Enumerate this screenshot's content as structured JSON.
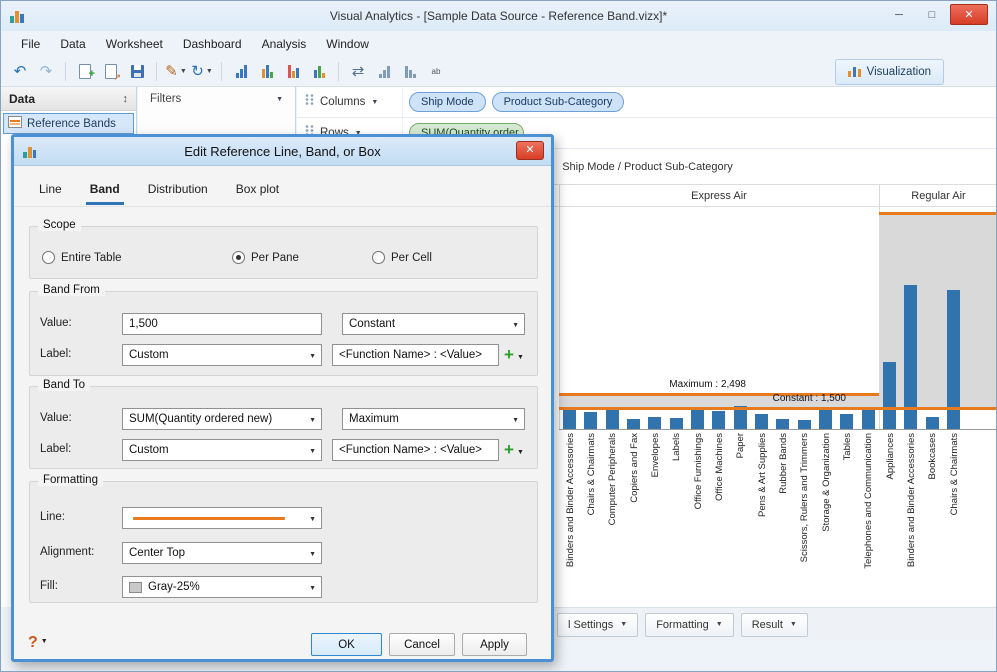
{
  "window": {
    "title": "Visual Analytics - [Sample Data Source - Reference Band.vizx]*",
    "menus": [
      "File",
      "Data",
      "Worksheet",
      "Dashboard",
      "Analysis",
      "Window"
    ],
    "visualization_tab": "Visualization"
  },
  "toolbar": {
    "icons": [
      "undo",
      "redo",
      "sep",
      "new-worksheet",
      "duplicate",
      "save",
      "sep",
      "format-painter",
      "refresh",
      "sep",
      "bar-chart",
      "dashboard",
      "highlight",
      "labels",
      "sep",
      "swap-axes",
      "sort-ascending",
      "sort-descending",
      "text-labels"
    ]
  },
  "panels": {
    "data_header": "Data",
    "reference_bands_item": "Reference Bands",
    "filters_header": "Filters",
    "columns_label": "Columns",
    "rows_label": "Rows",
    "column_pills": [
      "Ship Mode",
      "Product Sub-Category"
    ],
    "row_pills": [
      "SUM(Quantity order"
    ]
  },
  "bottom_bar": {
    "tabs": [
      "l Settings",
      "Formatting",
      "Result"
    ]
  },
  "dialog": {
    "title": "Edit Reference Line, Band, or Box",
    "tabs": [
      "Line",
      "Band",
      "Distribution",
      "Box plot"
    ],
    "active_tab": "Band",
    "scope": {
      "caption": "Scope",
      "options": [
        "Entire Table",
        "Per Pane",
        "Per Cell"
      ],
      "selected_index": 1
    },
    "band_from": {
      "caption": "Band From",
      "value_label": "Value:",
      "value": "1,500",
      "aggregation": "Constant",
      "label_label": "Label:",
      "label_mode": "Custom",
      "label_format": "<Function Name> : <Value>"
    },
    "band_to": {
      "caption": "Band To",
      "value_label": "Value:",
      "value": "SUM(Quantity ordered new)",
      "aggregation": "Maximum",
      "label_label": "Label:",
      "label_mode": "Custom",
      "label_format": "<Function Name> : <Value>"
    },
    "formatting": {
      "caption": "Formatting",
      "line_label": "Line:",
      "line_color": "#e87a1e",
      "alignment_label": "Alignment:",
      "alignment": "Center Top",
      "fill_label": "Fill:",
      "fill": "Gray-25%",
      "fill_swatch": "#c9c9c9"
    },
    "buttons": {
      "ok": "OK",
      "cancel": "Cancel",
      "apply": "Apply"
    }
  },
  "chart_data": {
    "type": "bar",
    "title": "Ship Mode / Product Sub-Category",
    "ylim": [
      0,
      16000
    ],
    "bar_color": "#3173ad",
    "band_color": "#d9d9d9",
    "refline_color": "#e87a1e",
    "panes": [
      {
        "name": "Express Air",
        "categories": [
          "Binders and Binder Accessories",
          "Chairs & Chairmats",
          "Computer Peripherals",
          "Copiers and Fax",
          "Envelopes",
          "Labels",
          "Office Furnishings",
          "Office Machines",
          "Paper",
          "Pens & Art Supplies",
          "Rubber Bands",
          "Scissors, Rulers and Trimmers",
          "Storage & Organization",
          "Tables",
          "Telephones and Communication"
        ],
        "values": [
          1600,
          1250,
          1600,
          700,
          900,
          800,
          1400,
          1300,
          1650,
          1100,
          700,
          650,
          1500,
          1050,
          1600
        ],
        "band": {
          "from": 1500,
          "to": 2498
        },
        "reference_lines": [
          {
            "label": "Maximum : 2,498",
            "value": 2498
          },
          {
            "label": "Constant : 1,500",
            "value": 1500
          }
        ]
      },
      {
        "name": "Regular Air",
        "categories": [
          "Appliances",
          "Binders and Binder Accessories",
          "Bookcases",
          "Chairs & Chairmats"
        ],
        "values": [
          4800,
          10400,
          900,
          10000
        ],
        "band": {
          "from": 1500,
          "to": 15500
        },
        "reference_lines": [
          {
            "label": "",
            "value": 15500
          },
          {
            "label": "",
            "value": 1500
          }
        ]
      }
    ]
  }
}
